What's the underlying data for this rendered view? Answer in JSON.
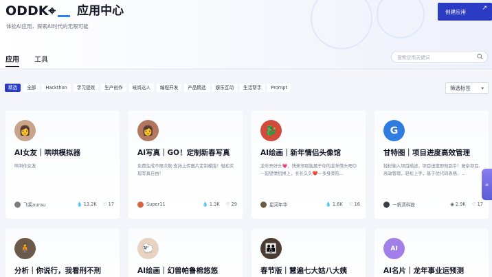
{
  "header": {
    "logo_letters": [
      "O",
      "D",
      "D",
      "K",
      "⌖"
    ],
    "title": "应用中心",
    "subtitle": "体验AI应用，探索AI时代的无限可能",
    "create_button": "创建应用"
  },
  "tabs": [
    {
      "label": "应用",
      "active": true
    },
    {
      "label": "工具",
      "active": false
    }
  ],
  "search": {
    "placeholder": "搜索应用关键词"
  },
  "tags": [
    {
      "label": "精选",
      "active": true
    },
    {
      "label": "全部",
      "active": false
    },
    {
      "label": "Hackthon",
      "active": false
    },
    {
      "label": "学习提效",
      "active": false
    },
    {
      "label": "生产创作",
      "active": false
    },
    {
      "label": "岐岚达人",
      "active": false
    },
    {
      "label": "编程开发",
      "active": false
    },
    {
      "label": "产品精选",
      "active": false
    },
    {
      "label": "娱乐互动",
      "active": false
    },
    {
      "label": "生活帮手",
      "active": false
    },
    {
      "label": "Prompt",
      "active": false
    }
  ],
  "filter": {
    "label": "筛选标签"
  },
  "cards": [
    {
      "title": "AI女友｜哄哄模拟器",
      "desc": "哄哄你女友",
      "author": "飞桨aurau",
      "views": "13.2K",
      "likes": "17",
      "avatar_color": "#c9a48b",
      "icon": "fire-icon"
    },
    {
      "title": "AI写真｜GO！定制新春写真",
      "desc": "免费生成不限次数·支持上传图片定制模版！轻松实现写真自由！",
      "author": "Super11",
      "views": "1.3K",
      "likes": "29",
      "avatar_color": "#b2785f",
      "icon": "fire-icon"
    },
    {
      "title": "AI绘画｜新年情侣头像馆",
      "desc": "龙年开好头💗，快来领取独属于你的龙年情头吧😊一起壁情侣换上，长长久久❤️一多身旁陪...",
      "author": "星河年华",
      "views": "1.6K",
      "likes": "16",
      "avatar_color": "#d24a3a",
      "icon": "fire-icon"
    },
    {
      "title": "甘特图｜项目进度高效管理",
      "desc": "轻松输入项目描述，项目进度即刻到手！复杂项目,高效管理，轻松上手，基于优代码表格，...",
      "author": "一帆清科技",
      "views": "2.9K",
      "likes": "17",
      "avatar_color": "#2f7de0",
      "icon": "eye-icon"
    },
    {
      "title": "分析｜你说行，我看刑不刑",
      "desc": "",
      "author": "",
      "views": "",
      "likes": "",
      "avatar_color": "#6b5a4a",
      "icon": ""
    },
    {
      "title": "AI绘画｜幻兽帕鲁棉悠悠",
      "desc": "",
      "author": "",
      "views": "",
      "likes": "",
      "avatar_color": "#e8d2c2",
      "icon": ""
    },
    {
      "title": "春节版｜慧遍七大姑八大姨",
      "desc": "",
      "author": "",
      "views": "",
      "likes": "",
      "avatar_color": "#4a3b33",
      "icon": ""
    },
    {
      "title": "AI名片｜龙年事业运预测",
      "desc": "",
      "author": "",
      "views": "",
      "likes": "",
      "avatar_color": "#a27ee8",
      "icon": ""
    }
  ],
  "float_tab": {
    "label": "≡"
  }
}
